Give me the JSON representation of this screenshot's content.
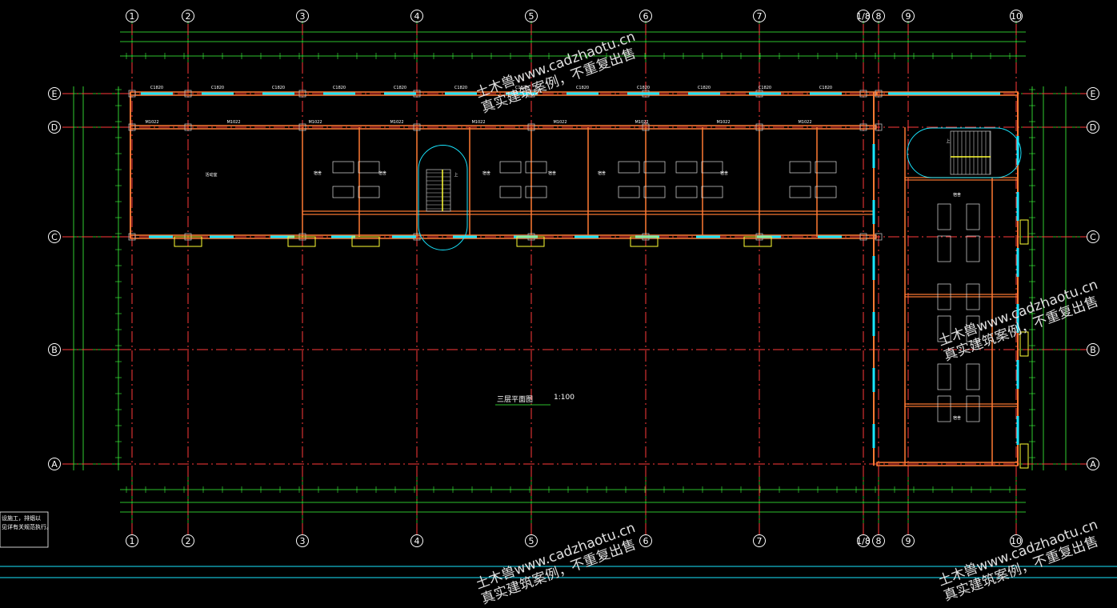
{
  "plan": {
    "title": "三层平面图",
    "scale": "1:100",
    "note_lines": [
      "设施工，排烟以",
      "见详有关规范执行。"
    ]
  },
  "axes": {
    "columns": [
      "1",
      "2",
      "3",
      "4",
      "5",
      "6",
      "7",
      "1/8",
      "8",
      "9",
      "10"
    ],
    "rows": [
      "E",
      "D",
      "C",
      "B",
      "A"
    ]
  },
  "labels": {
    "window_codes": [
      "C1820",
      "C1820",
      "C1820",
      "C1820",
      "C1820",
      "C1820",
      "C1820",
      "C1820",
      "C1820",
      "C1820",
      "C1820",
      "C1820"
    ],
    "door_codes": [
      "M1022",
      "M1022",
      "M1022",
      "M1022",
      "M1022",
      "M1022",
      "M1022",
      "M1022",
      "M1022"
    ],
    "stair_mark": "上",
    "rooms": [
      "活动室",
      "宿舍",
      "宿舍",
      "宿舍",
      "宿舍",
      "宿舍",
      "宿舍",
      "宿舍",
      "宿舍"
    ]
  },
  "watermark": {
    "line1": "土木兽www.cadzhaotu.cn",
    "line2": "真实建筑案例，不重复出售"
  },
  "colors": {
    "grid": "#ff3a3a",
    "dimension": "#3dff3d",
    "wall": "#ff7a33",
    "window": "#19e6ff",
    "accent": "#ffff33",
    "text": "#ffffff"
  }
}
